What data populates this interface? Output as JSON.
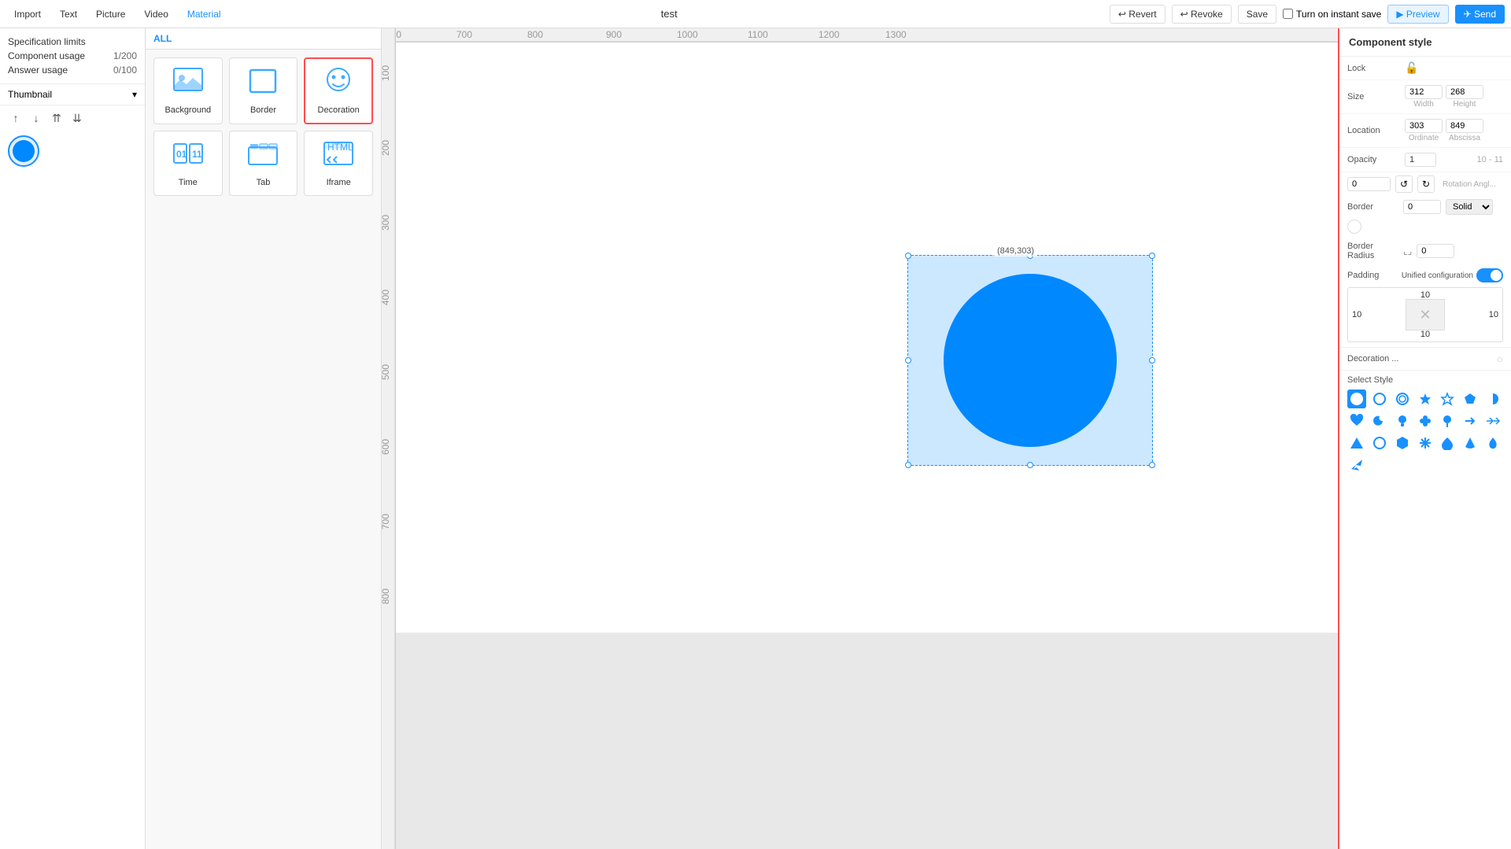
{
  "toolbar": {
    "import": "Import",
    "text": "Text",
    "picture": "Picture",
    "video": "Video",
    "material": "Material",
    "title": "test",
    "revert": "Revert",
    "revoke": "Revoke",
    "save": "Save",
    "instant_save": "Turn on instant save",
    "preview": "Preview",
    "send": "Send"
  },
  "left_panel": {
    "spec_limits": "Specification limits",
    "component_usage": "Component usage",
    "component_value": "1/200",
    "answer_usage": "Answer usage",
    "answer_value": "0/100",
    "thumbnail": "Thumbnail"
  },
  "component_panel": {
    "all_label": "ALL",
    "items": [
      {
        "label": "Background",
        "icon": "🖼"
      },
      {
        "label": "Border",
        "icon": "⬜"
      },
      {
        "label": "Decoration",
        "icon": "😊"
      },
      {
        "label": "Time",
        "icon": "🕐"
      },
      {
        "label": "Tab",
        "icon": "📑"
      },
      {
        "label": "Iframe",
        "icon": "🌐"
      }
    ]
  },
  "canvas": {
    "coord_label": "(849,303)"
  },
  "right_panel": {
    "title": "Component style",
    "lock_label": "Lock",
    "size_label": "Size",
    "width_value": "312",
    "height_value": "268",
    "width_sub": "Width",
    "height_sub": "Height",
    "location_label": "Location",
    "ordinate_value": "303",
    "abscissa_value": "849",
    "ordinate_sub": "Ordinate",
    "abscissa_sub": "Abscissa",
    "opacity_label": "Opacity",
    "opacity_value": "1",
    "rotation_value": "0",
    "rotation_sub": "Rotation Angl...",
    "border_label": "Border",
    "border_value": "0",
    "border_style": "Solid",
    "border_radius_label": "Border Radius",
    "border_radius_value": "0",
    "padding_label": "Padding",
    "unified_label": "Unified configuration",
    "padding_top": "10",
    "padding_bottom": "10",
    "padding_left": "10",
    "padding_right": "10",
    "decoration_label": "Decoration ...",
    "select_style_label": "Select Style"
  },
  "shapes": [
    "●",
    "○",
    "◯",
    "★",
    "☆",
    "⬟",
    "◑",
    "♥",
    "☽",
    "💡",
    "❋",
    "📍",
    "→",
    "⇒",
    "▶",
    "◎",
    "⬡",
    "✿",
    "▾",
    "💧",
    "🔥",
    "✈"
  ]
}
